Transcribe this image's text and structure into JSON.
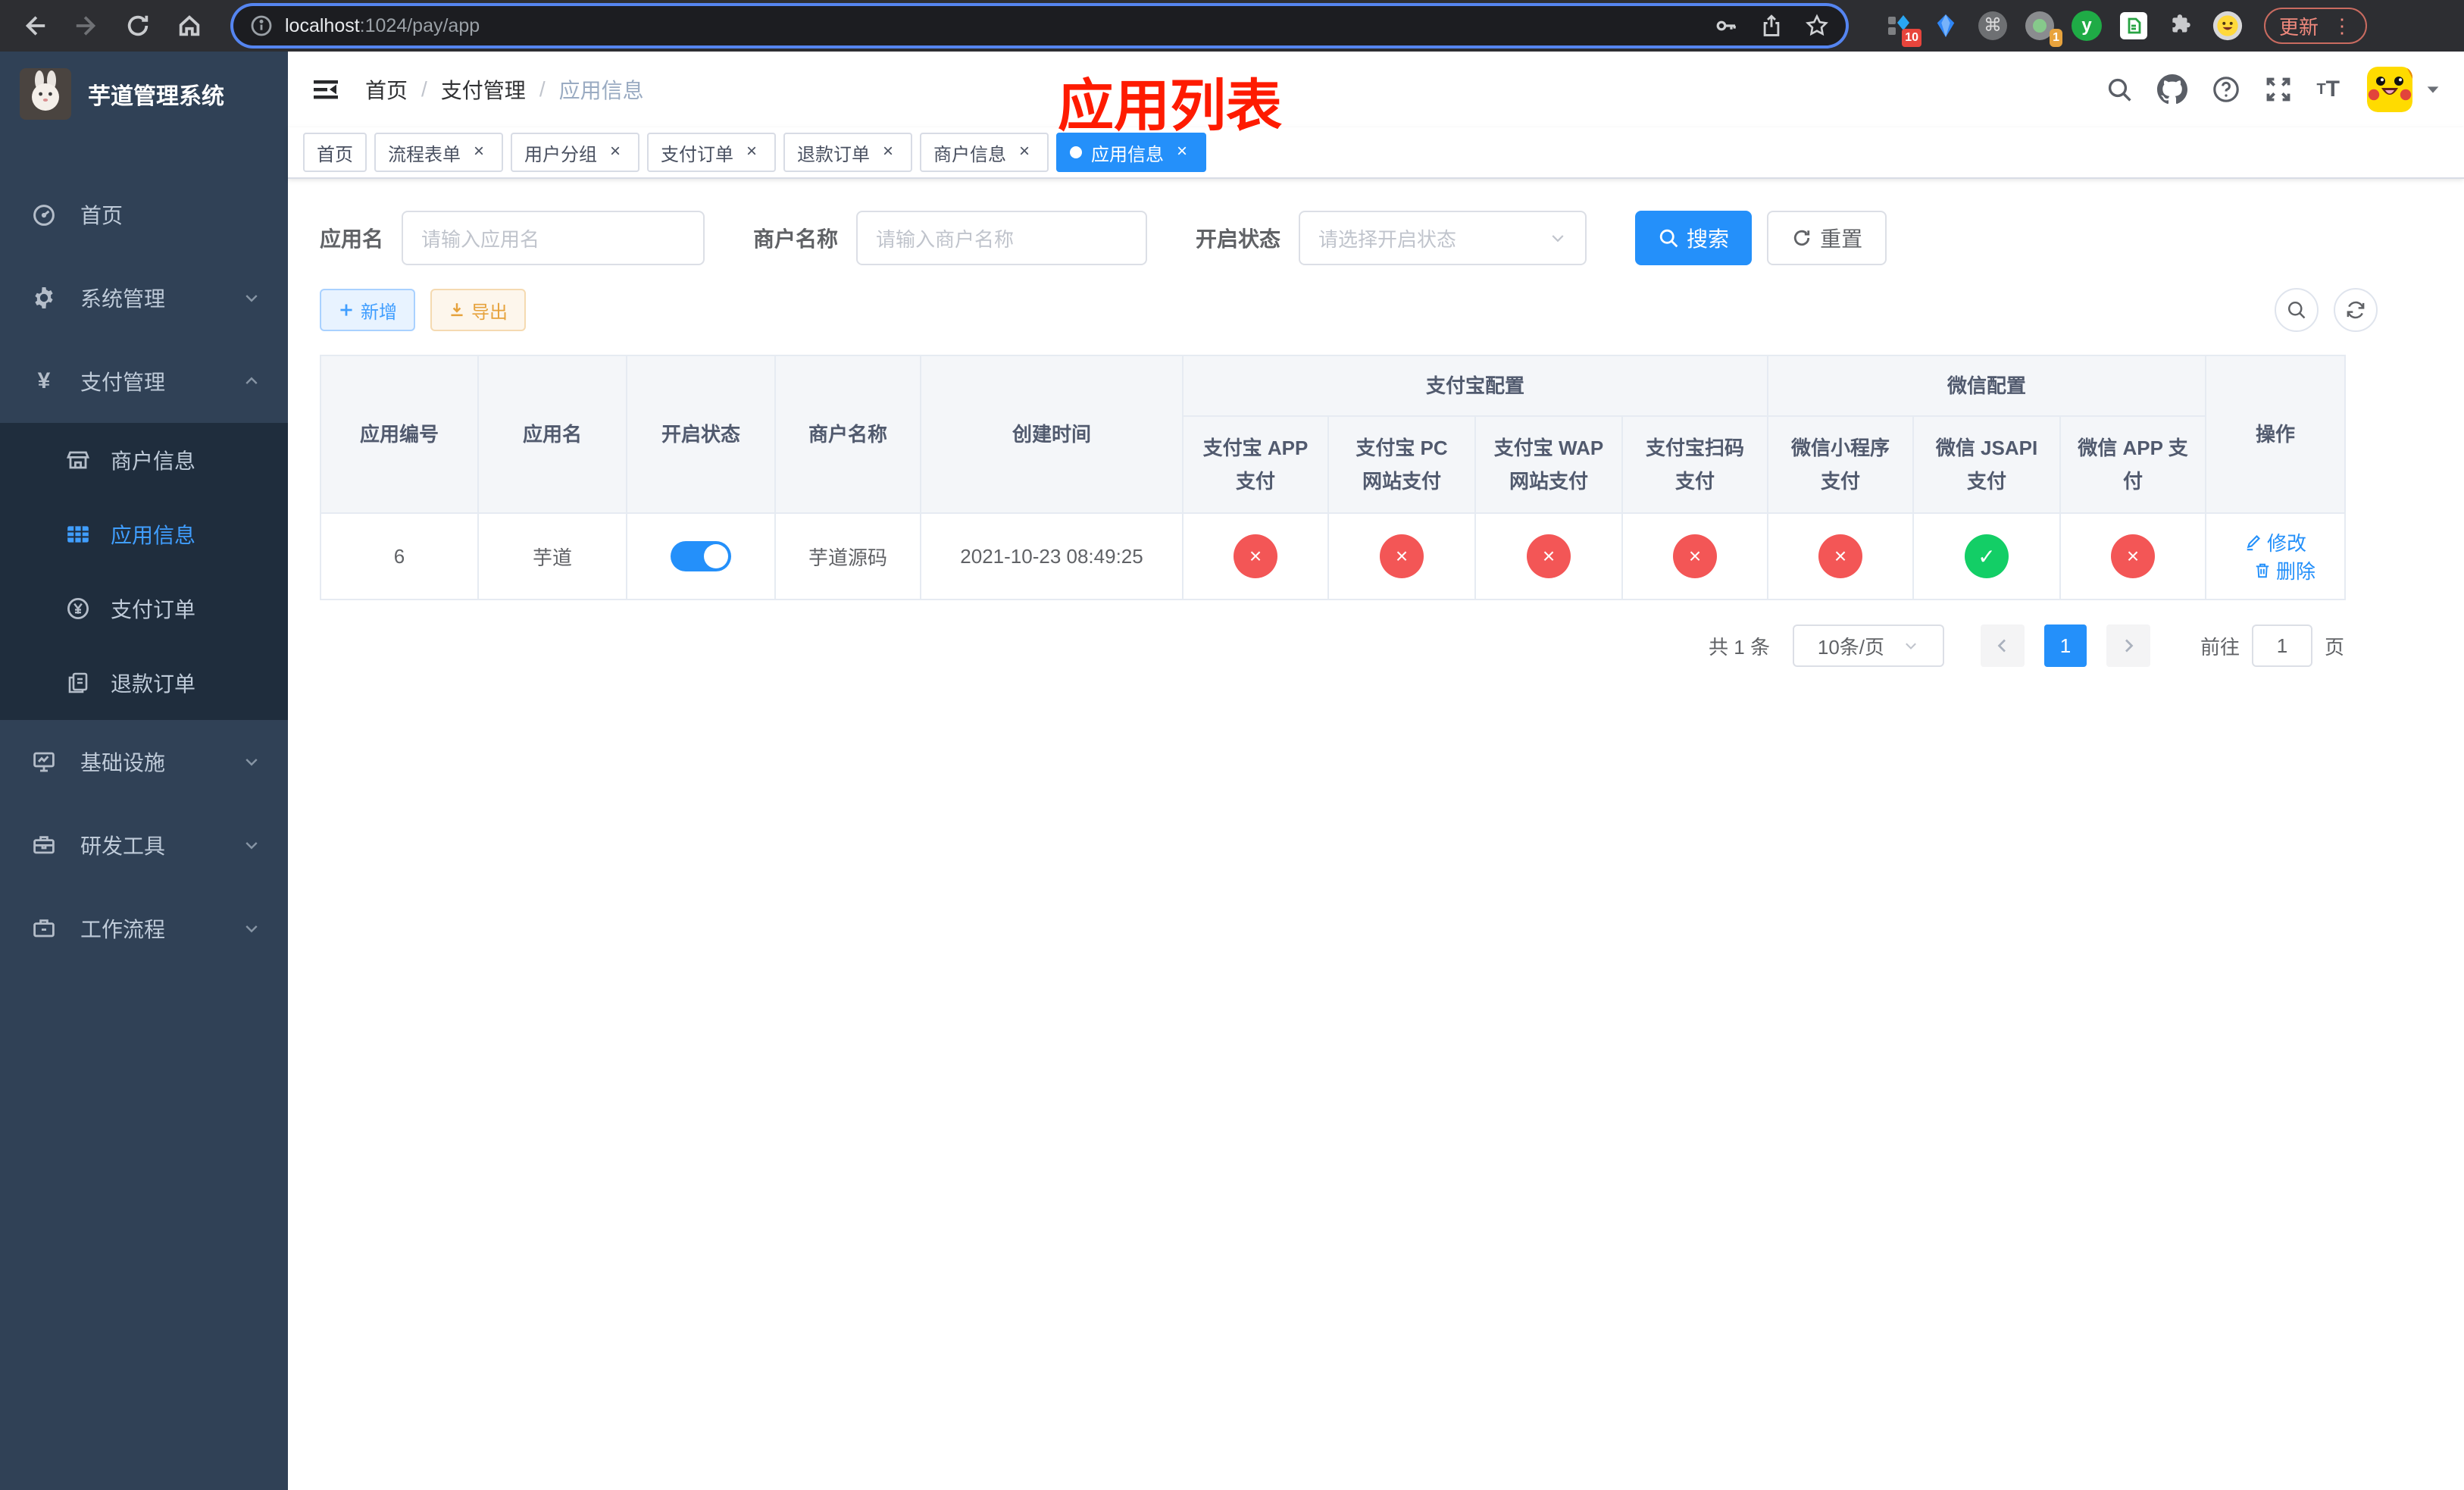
{
  "colors": {
    "primary": "#2490fa",
    "success": "#13ce66",
    "danger": "#f35656",
    "warning": "#e6a23c",
    "sidebar_bg": "#304156",
    "submenu_bg": "#1f2d3d"
  },
  "browser": {
    "url_host": "localhost",
    "url_rest": ":1024/pay/app",
    "update_label": "更新",
    "ext_badge_10": "10",
    "ext_badge_1": "1",
    "ext_y": "y",
    "cmd": "⌘"
  },
  "icons": {
    "close": "×",
    "check": "✓",
    "cross": "×",
    "yuan": "¥",
    "kebab": "⋮"
  },
  "sidebar": {
    "title": "芋道管理系统",
    "items": [
      {
        "label": "首页"
      },
      {
        "label": "系统管理"
      },
      {
        "label": "支付管理"
      },
      {
        "label": "基础设施"
      },
      {
        "label": "研发工具"
      },
      {
        "label": "工作流程"
      }
    ],
    "submenu": [
      {
        "label": "商户信息"
      },
      {
        "label": "应用信息"
      },
      {
        "label": "支付订单"
      },
      {
        "label": "退款订单"
      }
    ]
  },
  "navbar": {
    "breadcrumb": [
      "首页",
      "支付管理",
      "应用信息"
    ],
    "separator": "/"
  },
  "annotation": "应用列表",
  "tabs": [
    {
      "label": "首页"
    },
    {
      "label": "流程表单"
    },
    {
      "label": "用户分组"
    },
    {
      "label": "支付订单"
    },
    {
      "label": "退款订单"
    },
    {
      "label": "商户信息"
    },
    {
      "label": "应用信息"
    }
  ],
  "filters": {
    "name_label": "应用名",
    "name_placeholder": "请输入应用名",
    "merchant_label": "商户名称",
    "merchant_placeholder": "请输入商户名称",
    "status_label": "开启状态",
    "status_placeholder": "请选择开启状态",
    "search_label": "搜索",
    "reset_label": "重置"
  },
  "toolbar": {
    "add_label": "新增",
    "export_label": "导出"
  },
  "table": {
    "col_id": "应用编号",
    "col_name": "应用名",
    "col_status": "开启状态",
    "col_merchant": "商户名称",
    "col_created": "创建时间",
    "group_alipay": "支付宝配置",
    "group_wechat": "微信配置",
    "col_action": "操作",
    "sub": [
      "支付宝 APP 支付",
      "支付宝 PC 网站支付",
      "支付宝 WAP 网站支付",
      "支付宝扫码支付",
      "微信小程序支付",
      "微信 JSAPI 支付",
      "微信 APP 支付"
    ],
    "row": {
      "id": "6",
      "name": "芋道",
      "enabled": true,
      "merchant": "芋道源码",
      "created": "2021-10-23 08:49:25",
      "channels": [
        false,
        false,
        false,
        false,
        false,
        true,
        false
      ],
      "edit_label": "修改",
      "delete_label": "删除"
    }
  },
  "pagination": {
    "total": "共 1 条",
    "size": "10条/页",
    "page": "1",
    "goto_label": "前往",
    "goto_value": "1",
    "unit": "页"
  }
}
